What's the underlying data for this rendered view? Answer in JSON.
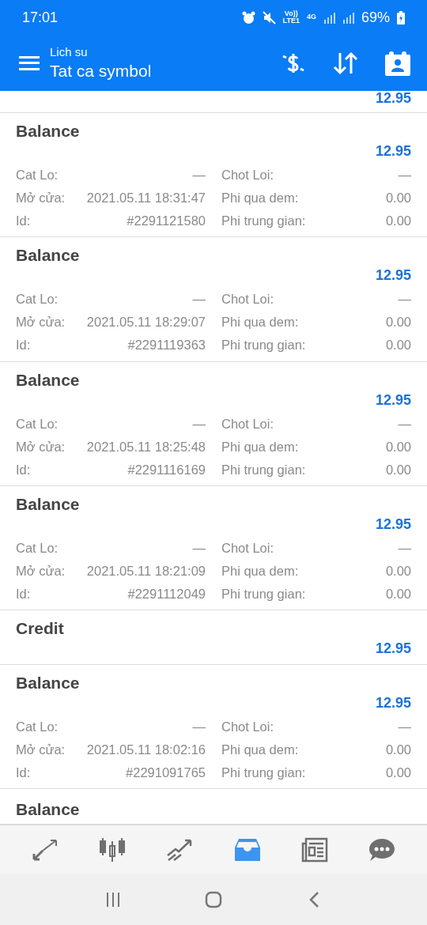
{
  "status_bar": {
    "time": "17:01",
    "battery": "69%",
    "network": "4G",
    "volte": "Vo))\nLTE1"
  },
  "header": {
    "subtitle": "Lich su",
    "title": "Tat ca symbol"
  },
  "partial_top": {
    "amount": "12.95"
  },
  "deals": [
    {
      "kind": "full",
      "type": "Balance",
      "amount": "12.95",
      "fields": [
        [
          "Cat Lo:",
          "—",
          "Chot Loi:",
          "—"
        ],
        [
          "Mở cửa:",
          "2021.05.11 18:31:47",
          "Phi qua dem:",
          "0.00"
        ],
        [
          "Id:",
          "#2291121580",
          "Phi trung gian:",
          "0.00"
        ]
      ]
    },
    {
      "kind": "full",
      "type": "Balance",
      "amount": "12.95",
      "fields": [
        [
          "Cat Lo:",
          "—",
          "Chot Loi:",
          "—"
        ],
        [
          "Mở cửa:",
          "2021.05.11 18:29:07",
          "Phi qua dem:",
          "0.00"
        ],
        [
          "Id:",
          "#2291119363",
          "Phi trung gian:",
          "0.00"
        ]
      ]
    },
    {
      "kind": "full",
      "type": "Balance",
      "amount": "12.95",
      "fields": [
        [
          "Cat Lo:",
          "—",
          "Chot Loi:",
          "—"
        ],
        [
          "Mở cửa:",
          "2021.05.11 18:25:48",
          "Phi qua dem:",
          "0.00"
        ],
        [
          "Id:",
          "#2291116169",
          "Phi trung gian:",
          "0.00"
        ]
      ]
    },
    {
      "kind": "full",
      "type": "Balance",
      "amount": "12.95",
      "fields": [
        [
          "Cat Lo:",
          "—",
          "Chot Loi:",
          "—"
        ],
        [
          "Mở cửa:",
          "2021.05.11 18:21:09",
          "Phi qua dem:",
          "0.00"
        ],
        [
          "Id:",
          "#2291112049",
          "Phi trung gian:",
          "0.00"
        ]
      ]
    },
    {
      "kind": "simple",
      "type": "Credit",
      "amount": "12.95"
    },
    {
      "kind": "full",
      "type": "Balance",
      "amount": "12.95",
      "fields": [
        [
          "Cat Lo:",
          "—",
          "Chot Loi:",
          "—"
        ],
        [
          "Mở cửa:",
          "2021.05.11 18:02:16",
          "Phi qua dem:",
          "0.00"
        ],
        [
          "Id:",
          "#2291091765",
          "Phi trung gian:",
          "0.00"
        ]
      ]
    },
    {
      "kind": "cut",
      "type": "Balance"
    }
  ],
  "bottom_nav": [
    {
      "kind": "quotes",
      "selected": false
    },
    {
      "kind": "chart",
      "selected": false
    },
    {
      "kind": "trade",
      "selected": false
    },
    {
      "kind": "history",
      "selected": true
    },
    {
      "kind": "news",
      "selected": false
    },
    {
      "kind": "chat",
      "selected": false
    }
  ]
}
